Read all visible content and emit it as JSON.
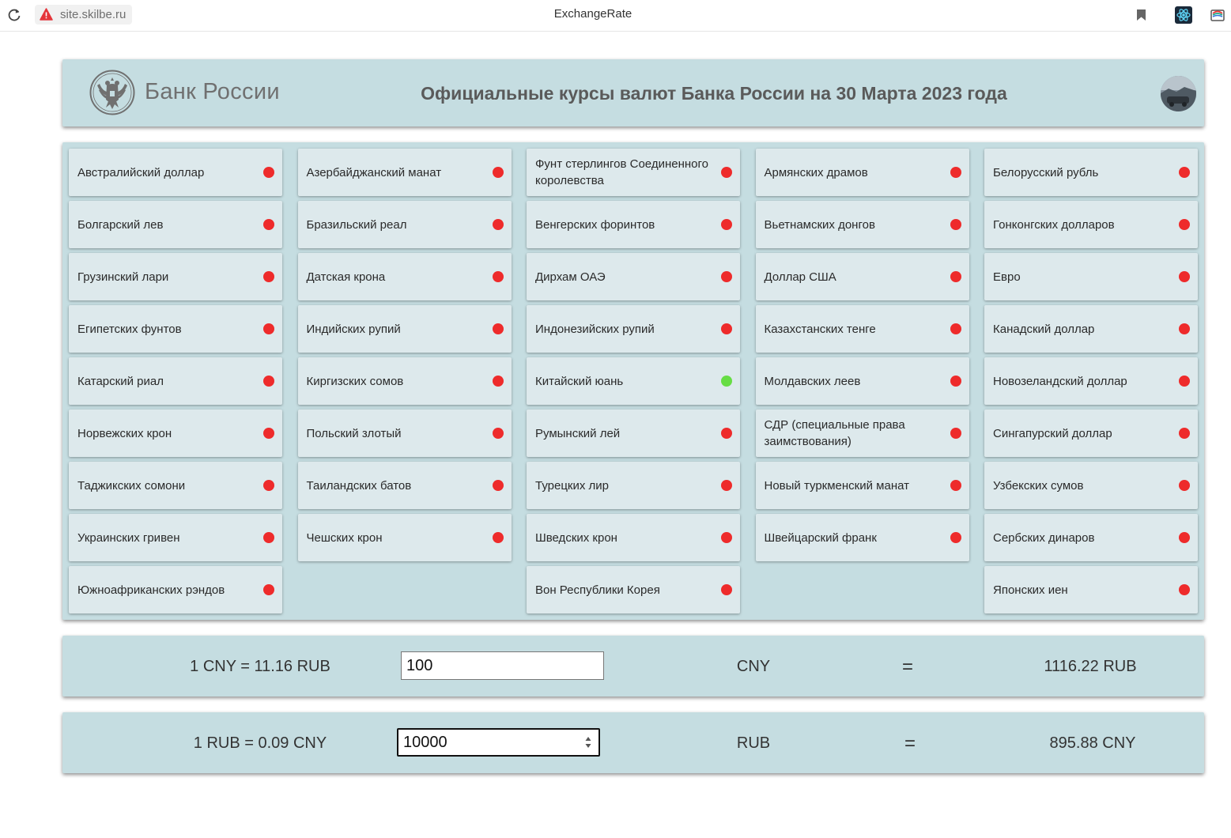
{
  "browser": {
    "url": "site.skilbe.ru",
    "tab_title": "ExchangeRate"
  },
  "header": {
    "logo_text": "Банк России",
    "title": "Официальные курсы валют Банка России на 30 Марта 2023 года"
  },
  "currencies": [
    [
      {
        "label": "Австралийский доллар",
        "selected": false
      },
      {
        "label": "Азербайджанский манат",
        "selected": false
      },
      {
        "label": "Фунт стерлингов Соединенного королевства",
        "selected": false
      },
      {
        "label": "Армянских драмов",
        "selected": false
      },
      {
        "label": "Белорусский рубль",
        "selected": false
      }
    ],
    [
      {
        "label": "Болгарский лев",
        "selected": false
      },
      {
        "label": "Бразильский реал",
        "selected": false
      },
      {
        "label": "Венгерских форинтов",
        "selected": false
      },
      {
        "label": "Вьетнамских донгов",
        "selected": false
      },
      {
        "label": "Гонконгских долларов",
        "selected": false
      }
    ],
    [
      {
        "label": "Грузинский лари",
        "selected": false
      },
      {
        "label": "Датская крона",
        "selected": false
      },
      {
        "label": "Дирхам ОАЭ",
        "selected": false
      },
      {
        "label": "Доллар США",
        "selected": false
      },
      {
        "label": "Евро",
        "selected": false
      }
    ],
    [
      {
        "label": "Египетских фунтов",
        "selected": false
      },
      {
        "label": "Индийских рупий",
        "selected": false
      },
      {
        "label": "Индонезийских рупий",
        "selected": false
      },
      {
        "label": "Казахстанских тенге",
        "selected": false
      },
      {
        "label": "Канадский доллар",
        "selected": false
      }
    ],
    [
      {
        "label": "Катарский риал",
        "selected": false
      },
      {
        "label": "Киргизских сомов",
        "selected": false
      },
      {
        "label": "Китайский юань",
        "selected": true
      },
      {
        "label": "Молдавских леев",
        "selected": false
      },
      {
        "label": "Новозеландский доллар",
        "selected": false
      }
    ],
    [
      {
        "label": "Норвежских крон",
        "selected": false
      },
      {
        "label": "Польский злотый",
        "selected": false
      },
      {
        "label": "Румынский лей",
        "selected": false
      },
      {
        "label": "СДР (специальные права заимствования)",
        "selected": false
      },
      {
        "label": "Сингапурский доллар",
        "selected": false
      }
    ],
    [
      {
        "label": "Таджикских сомони",
        "selected": false
      },
      {
        "label": "Таиландских батов",
        "selected": false
      },
      {
        "label": "Турецких лир",
        "selected": false
      },
      {
        "label": "Новый туркменский манат",
        "selected": false
      },
      {
        "label": "Узбекских сумов",
        "selected": false
      }
    ],
    [
      {
        "label": "Украинских гривен",
        "selected": false
      },
      {
        "label": "Чешских крон",
        "selected": false
      },
      {
        "label": "Шведских крон",
        "selected": false
      },
      {
        "label": "Швейцарский франк",
        "selected": false
      },
      {
        "label": "Сербских динаров",
        "selected": false
      }
    ],
    [
      {
        "label": "Южноафриканских рэндов",
        "selected": false
      },
      null,
      {
        "label": "Вон Республики Корея",
        "selected": false
      },
      null,
      {
        "label": "Японских иен",
        "selected": false
      }
    ]
  ],
  "colors": {
    "dot_inactive": "#ee2b2b",
    "dot_active": "#66dd44",
    "panel": "#c5dde1",
    "cell": "#dde9ec"
  },
  "converter_cny_to_rub": {
    "rate_text": "1 CNY  =  11.16 RUB",
    "input_value": "100",
    "unit": "CNY",
    "equals": "=",
    "result": "1116.22 RUB"
  },
  "converter_rub_to_cny": {
    "rate_text": "1 RUB  =  0.09 CNY",
    "input_value": "10000",
    "unit": "RUB",
    "equals": "=",
    "result": "895.88 CNY"
  }
}
